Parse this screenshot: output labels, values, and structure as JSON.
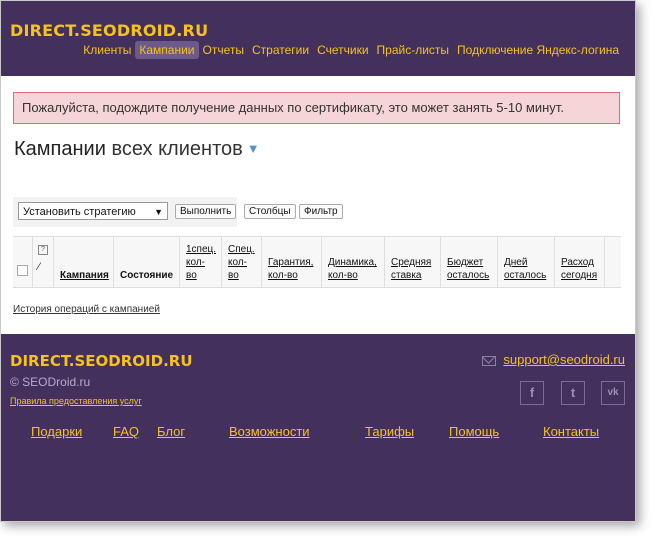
{
  "header": {
    "logo": "DIRECT.SEODROID.RU",
    "nav": [
      {
        "label": "Клиенты"
      },
      {
        "label": "Кампании"
      },
      {
        "label": "Отчеты"
      },
      {
        "label": "Стратегии"
      },
      {
        "label": "Счетчики"
      },
      {
        "label": "Прайс-листы"
      },
      {
        "label": "Подключение Яндекс-логина"
      }
    ],
    "active_nav": "Кампании"
  },
  "alert": {
    "text": "Пожалуйста, подождите получение данных по сертификату, это может занять 5-10 минут."
  },
  "page": {
    "title": "Кампании",
    "subtitle": "всех клиентов"
  },
  "toolbar": {
    "strategy_select": "Установить стратегию",
    "execute_label": "Выполнить",
    "columns_label": "Столбцы",
    "filter_label": "Фильтр"
  },
  "table": {
    "headers": [
      "Кампания",
      "Состояние",
      "1спец. кол- во",
      "Спец. кол- во",
      "Гарантия, кол-во",
      "Динамика, кол-во",
      "Средняя ставка",
      "Бюджет осталось",
      "Дней осталось",
      "Расход сегодня"
    ],
    "help_icon_label": "?"
  },
  "history_link": "История операций с кампанией",
  "footer": {
    "logo": "DIRECT.SEODROID.RU",
    "copyright": "© SEODroid.ru",
    "terms": "Правила предоставления услуг",
    "email": "support@seodroid.ru",
    "social": [
      "f",
      "t",
      "vk"
    ],
    "links": [
      "Подарки",
      "FAQ",
      "Блог",
      "Возможности",
      "Тарифы",
      "Помощь",
      "Контакты"
    ]
  },
  "colors": {
    "header_bg": "#43305c",
    "accent": "#f5c31c",
    "alert_bg": "#f5d5d7",
    "alert_border": "#e26a73"
  }
}
